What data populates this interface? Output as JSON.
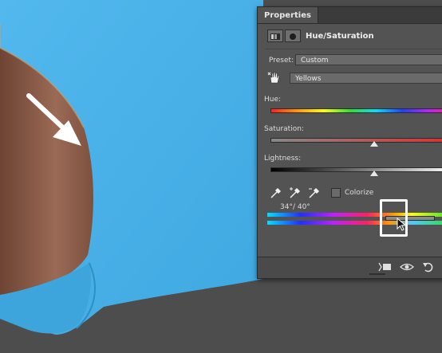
{
  "panel": {
    "tab_title": "Properties",
    "adjustment_title": "Hue/Saturation",
    "preset_label": "Preset:",
    "preset_value": "Custom",
    "range_value": "Yellows",
    "hue_label": "Hue:",
    "saturation_label": "Saturation:",
    "lightness_label": "Lightness:",
    "colorize_label": "Colorize",
    "range_readout": "34°/ 40°",
    "colorize_checked": false
  },
  "colors": {
    "shirt": "#4cb3ea",
    "skin": "#8a5a45",
    "panel_bg": "#535353"
  },
  "icons": [
    "hue-saturation-adjustment-icon",
    "layer-mask-icon",
    "targeted-adjustment-hand-icon",
    "eyedropper-icon",
    "eyedropper-add-icon",
    "eyedropper-subtract-icon",
    "clip-to-layer-icon",
    "visibility-eye-icon",
    "reset-icon",
    "cursor-arrow-icon",
    "annotation-arrow-icon"
  ]
}
